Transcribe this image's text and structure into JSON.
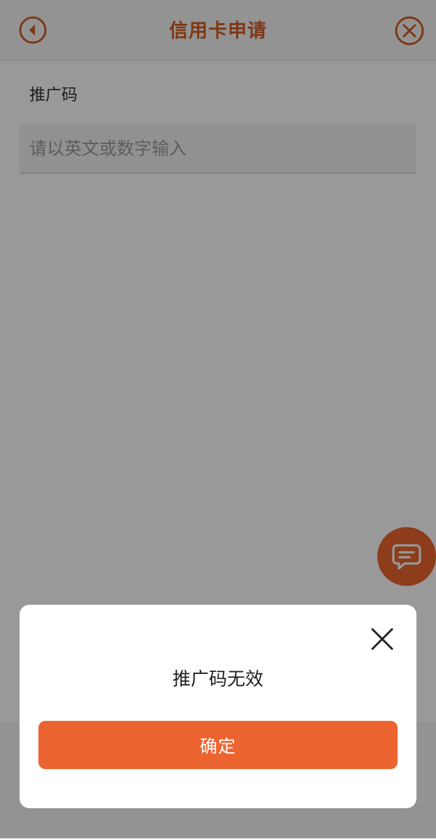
{
  "header": {
    "title": "信用卡申请",
    "back_icon": "back-arrow-circle-icon",
    "close_icon": "close-circle-icon"
  },
  "form": {
    "label": "推广码",
    "input_value": "",
    "input_placeholder": "请以英文或数字输入"
  },
  "chat_button": {
    "icon": "chat-bubble-icon"
  },
  "dialog": {
    "message": "推广码无效",
    "confirm_label": "确定",
    "close_icon": "close-icon"
  },
  "colors": {
    "accent": "#ec6430",
    "title": "#d45d24",
    "overlay": "rgba(0,0,0,0.40)"
  }
}
